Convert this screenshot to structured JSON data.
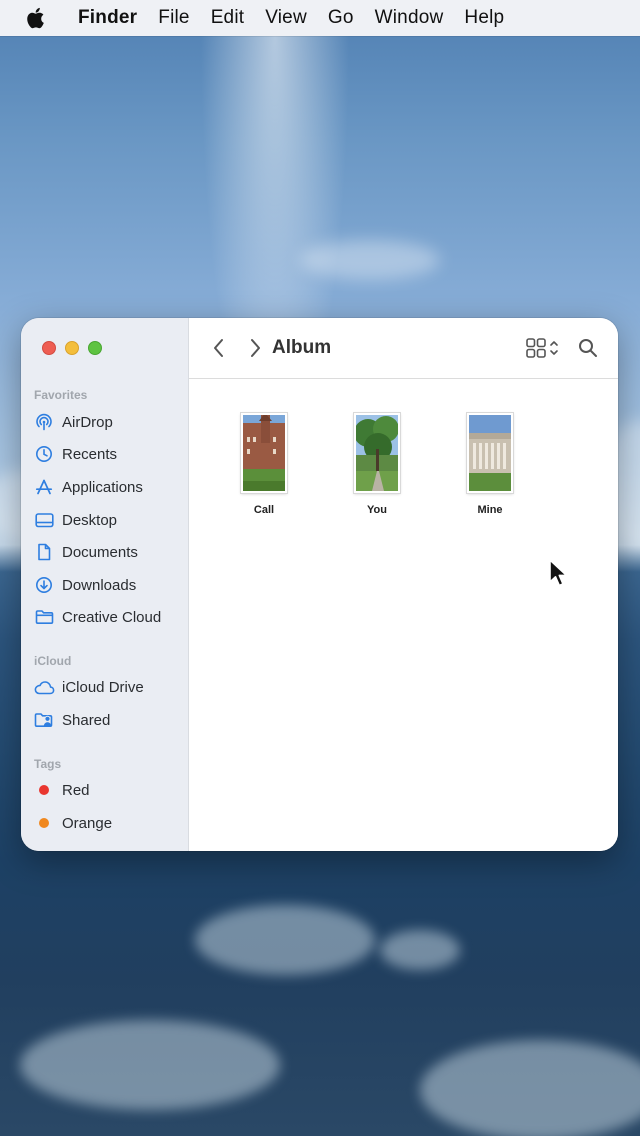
{
  "menubar": {
    "apple": "apple-logo-icon",
    "app": "Finder",
    "items": [
      "File",
      "Edit",
      "View",
      "Go",
      "Window",
      "Help"
    ]
  },
  "window": {
    "title": "Album",
    "sidebar": {
      "favorites_heading": "Favorites",
      "favorites": [
        {
          "label": "AirDrop",
          "icon": "airdrop-icon"
        },
        {
          "label": "Recents",
          "icon": "clock-icon"
        },
        {
          "label": "Applications",
          "icon": "applications-icon"
        },
        {
          "label": "Desktop",
          "icon": "desktop-icon"
        },
        {
          "label": "Documents",
          "icon": "document-icon"
        },
        {
          "label": "Downloads",
          "icon": "download-icon"
        },
        {
          "label": "Creative Cloud",
          "icon": "folder-icon"
        }
      ],
      "icloud_heading": "iCloud",
      "icloud": [
        {
          "label": "iCloud Drive",
          "icon": "cloud-icon"
        },
        {
          "label": "Shared",
          "icon": "shared-folder-icon"
        }
      ],
      "tags_heading": "Tags",
      "tags": [
        {
          "label": "Red",
          "color": "#e9362f"
        },
        {
          "label": "Orange",
          "color": "#f0881f"
        }
      ]
    },
    "files": [
      {
        "name": "Call"
      },
      {
        "name": "You"
      },
      {
        "name": "Mine"
      }
    ]
  },
  "colors": {
    "accent": "#2e7ee0"
  }
}
